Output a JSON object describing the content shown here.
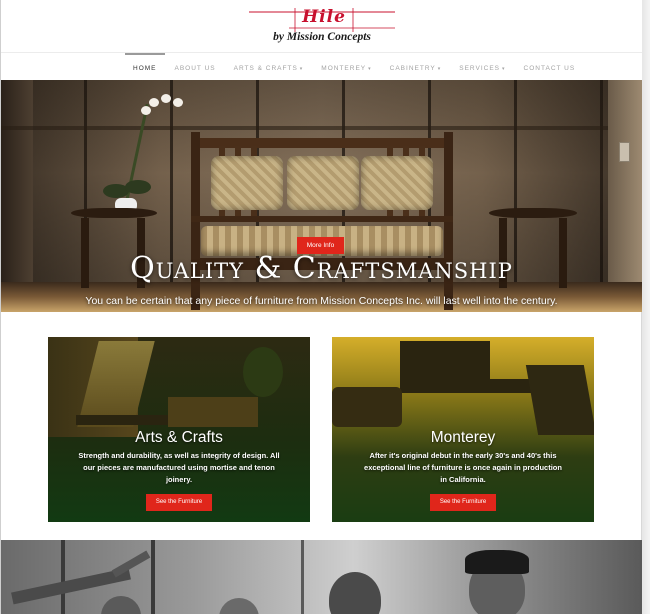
{
  "brand": {
    "signature": "Hile",
    "tagline": "by Mission Concepts",
    "accent_color": "#c8102e"
  },
  "nav": {
    "items": [
      {
        "label": "HOME",
        "active": true,
        "has_dropdown": false
      },
      {
        "label": "ABOUT US",
        "active": false,
        "has_dropdown": false
      },
      {
        "label": "ARTS & CRAFTS",
        "active": false,
        "has_dropdown": true
      },
      {
        "label": "MONTEREY",
        "active": false,
        "has_dropdown": true
      },
      {
        "label": "CABINETRY",
        "active": false,
        "has_dropdown": true
      },
      {
        "label": "SERVICES",
        "active": false,
        "has_dropdown": true
      },
      {
        "label": "CONTACT US",
        "active": false,
        "has_dropdown": false
      }
    ],
    "dropdown_glyph": "▾"
  },
  "hero": {
    "title": "Quality & Craftsmanship",
    "subtitle": "You can be certain that any piece of furniture from Mission Concepts Inc. will last well into the century.",
    "button_label": "More Info",
    "button_color": "#e0261b"
  },
  "cards": [
    {
      "title": "Arts & Crafts",
      "text": "Strength and durability, as well as integrity of design. All our pieces are manufactured using mortise and tenon joinery.",
      "button_label": "See the Furniture"
    },
    {
      "title": "Monterey",
      "text": "After it's original debut in the early 30's and 40's this exceptional line of furniture is once again in production in California.",
      "button_label": "See the Furniture"
    }
  ]
}
